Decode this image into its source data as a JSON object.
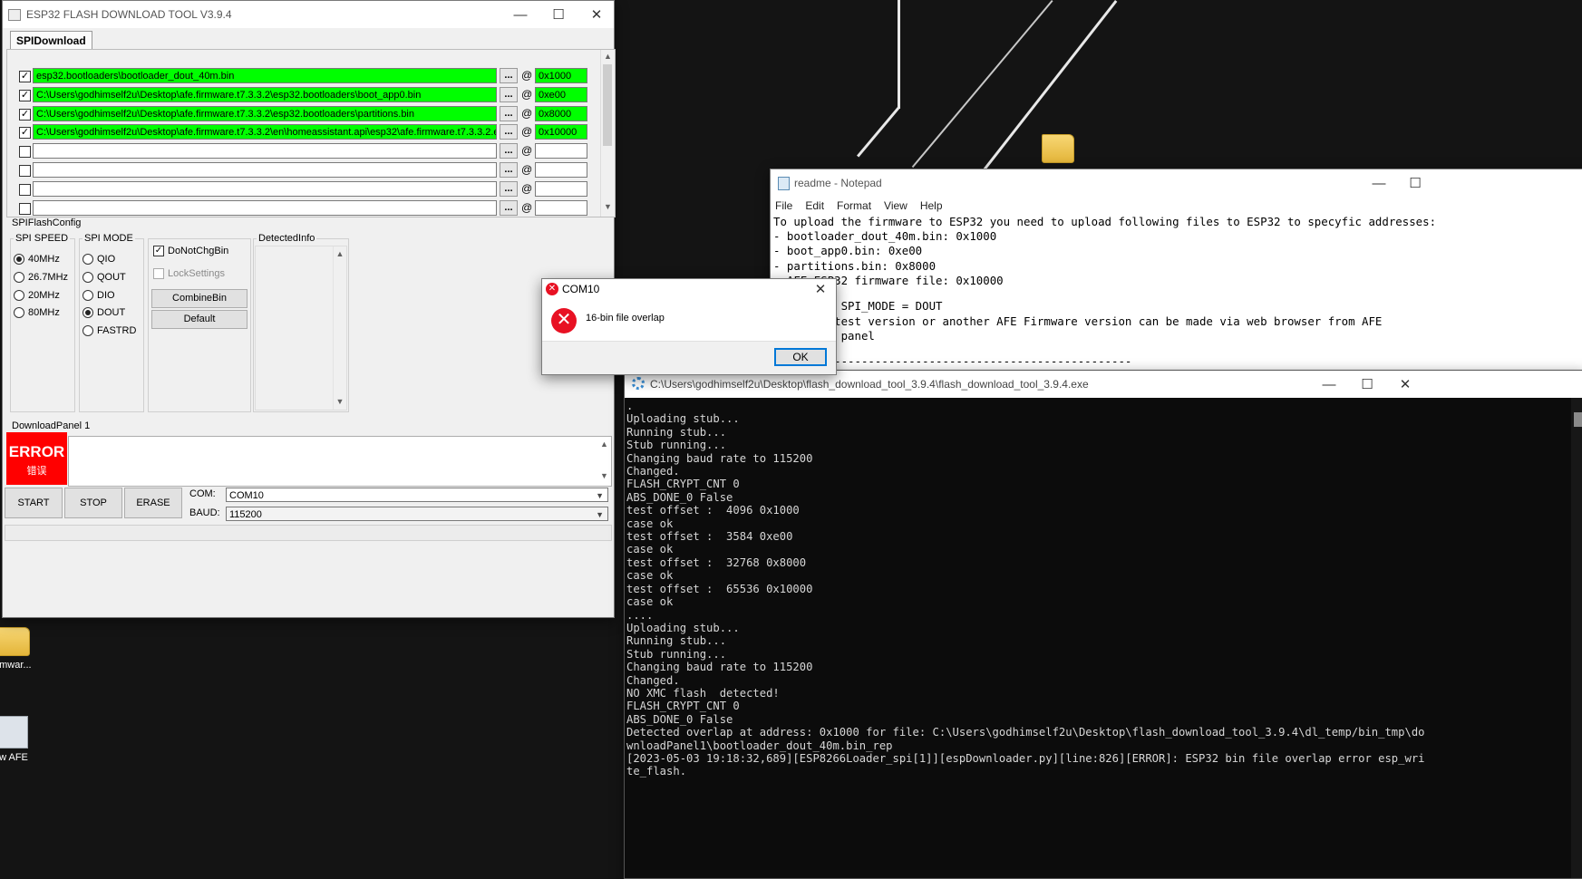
{
  "esp_tool": {
    "title": "ESP32 FLASH DOWNLOAD TOOL V3.9.4",
    "tab": "SPIDownload",
    "files": [
      {
        "checked": true,
        "path": "esp32.bootloaders\\bootloader_dout_40m.bin",
        "addr": "0x1000"
      },
      {
        "checked": true,
        "path": "C:\\Users\\godhimself2u\\Desktop\\afe.firmware.t7.3.3.2\\esp32.bootloaders\\boot_app0.bin",
        "addr": "0xe00"
      },
      {
        "checked": true,
        "path": "C:\\Users\\godhimself2u\\Desktop\\afe.firmware.t7.3.3.2\\esp32.bootloaders\\partitions.bin",
        "addr": "0x8000"
      },
      {
        "checked": true,
        "path": "C:\\Users\\godhimself2u\\Desktop\\afe.firmware.t7.3.3.2\\en\\homeassistant.api\\esp32\\afe.firmware.t7.3.3.2.en.",
        "addr": "0x10000"
      },
      {
        "checked": false,
        "path": "",
        "addr": ""
      },
      {
        "checked": false,
        "path": "",
        "addr": ""
      },
      {
        "checked": false,
        "path": "",
        "addr": ""
      },
      {
        "checked": false,
        "path": "",
        "addr": ""
      }
    ],
    "browse_label": "...",
    "at_sign": "@",
    "check_mark": "✓",
    "spi_flash_config_label": "SPIFlashConfig",
    "spi_speed_label": "SPI SPEED",
    "spi_speed_options": [
      "40MHz",
      "26.7MHz",
      "20MHz",
      "80MHz"
    ],
    "spi_speed_selected": 0,
    "spi_mode_label": "SPI MODE",
    "spi_mode_options": [
      "QIO",
      "QOUT",
      "DIO",
      "DOUT",
      "FASTRD"
    ],
    "spi_mode_selected": 3,
    "do_not_chg_bin": "DoNotChgBin",
    "lock_settings": "LockSettings",
    "combine_bin": "CombineBin",
    "default": "Default",
    "detected_info": "DetectedInfo",
    "download_panel": "DownloadPanel 1",
    "status_en": "ERROR",
    "status_cn": "错误",
    "start": "START",
    "stop": "STOP",
    "erase": "ERASE",
    "com_label": "COM:",
    "com_value": "COM10",
    "baud_label": "BAUD:",
    "baud_value": "115200"
  },
  "notepad": {
    "title": "readme - Notepad",
    "menu": [
      "File",
      "Edit",
      "Format",
      "View",
      "Help"
    ],
    "lines": [
      "To upload the firmware to ESP32 you need to upload following files to ESP32 to specyfic addresses:",
      "- bootloader_dout_40m.bin: 0x1000",
      "- boot_app0.bin: 0xe00",
      "- partitions.bin: 0x8000",
      "- AFE ESP32 firmware file: 0x10000",
      "",
      "      ing SPI_MODE = DOUT",
      "     e latest version or another AFE Firmware version can be made via web browser from AFE",
      "     tion panel",
      "",
      "         --------------------------------------------"
    ]
  },
  "console": {
    "title": "C:\\Users\\godhimself2u\\Desktop\\flash_download_tool_3.9.4\\flash_download_tool_3.9.4.exe",
    "lines": [
      ".",
      "Uploading stub...",
      "Running stub...",
      "Stub running...",
      "Changing baud rate to 115200",
      "Changed.",
      "FLASH_CRYPT_CNT 0",
      "ABS_DONE_0 False",
      "test offset :  4096 0x1000",
      "case ok",
      "test offset :  3584 0xe00",
      "case ok",
      "test offset :  32768 0x8000",
      "case ok",
      "test offset :  65536 0x10000",
      "case ok",
      "....",
      "Uploading stub...",
      "Running stub...",
      "Stub running...",
      "Changing baud rate to 115200",
      "Changed.",
      "NO XMC flash  detected!",
      "FLASH_CRYPT_CNT 0",
      "ABS_DONE_0 False",
      "Detected overlap at address: 0x1000 for file: C:\\Users\\godhimself2u\\Desktop\\flash_download_tool_3.9.4\\dl_temp/bin_tmp\\do",
      "wnloadPanel1\\bootloader_dout_40m.bin_rep",
      "[2023-05-03 19:18:32,689][ESP8266Loader_spi[1]][espDownloader.py][line:826][ERROR]: ESP32 bin file overlap error esp_wri",
      "te_flash."
    ]
  },
  "dialog": {
    "title": "COM10",
    "message": "16-bin file overlap",
    "ok": "OK"
  },
  "desktop": {
    "icon1_label": "rmwar...",
    "icon2_label": "w AFE"
  },
  "window_controls": {
    "minimize": "—",
    "maximize": "☐",
    "close": "✕"
  },
  "colors": {
    "green": "#00ff00",
    "error_red": "#ff0000",
    "accent": "#0078d7"
  }
}
